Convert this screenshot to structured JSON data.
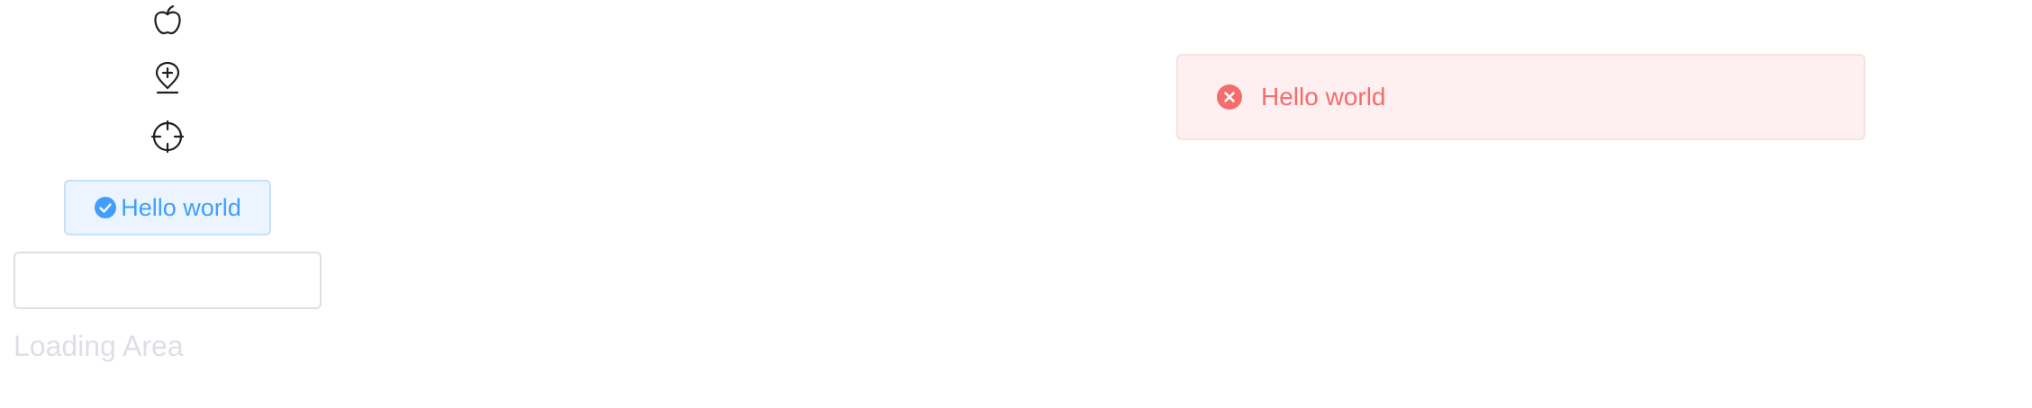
{
  "icons": {
    "apple": "apple-icon",
    "pin": "location-add-icon",
    "target": "aim-icon"
  },
  "tag": {
    "icon": "success-filled-icon",
    "label": "Hello world",
    "color": "#409eff",
    "background": "#ecf5ff",
    "border": "#c5e0fb"
  },
  "input": {
    "value": "",
    "placeholder": ""
  },
  "loading": {
    "text": "Loading Area",
    "color": "#dcdfe6"
  },
  "alert": {
    "icon": "circle-close-filled-icon",
    "title": "Hello world",
    "type": "error",
    "color": "#f56c6c",
    "background": "#fef0f0"
  }
}
